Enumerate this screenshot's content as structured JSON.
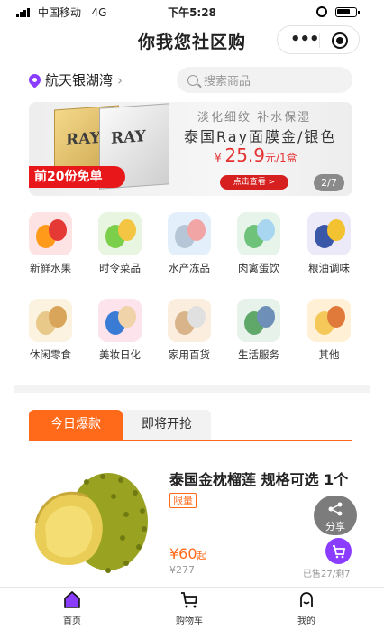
{
  "status_bar": {
    "carrier": "中国移动",
    "network": "4G",
    "time": "下午5:28"
  },
  "header": {
    "title": "你我您社区购"
  },
  "location": {
    "name": "航天银湖湾"
  },
  "search": {
    "placeholder": "搜索商品"
  },
  "banner": {
    "subtitle": "淡化细纹 补水保湿",
    "title": "泰国Ray面膜金/银色",
    "price_symbol": "¥",
    "price": "25.9",
    "price_unit": "元/1盒",
    "button_label": "点击查看 >",
    "promo": "前20份免单",
    "brand_text": "RAY",
    "page_indicator": "2/7"
  },
  "categories": [
    {
      "label": "新鲜水果",
      "icon": "fruit-icon"
    },
    {
      "label": "时令菜品",
      "icon": "vegetable-icon"
    },
    {
      "label": "水产冻品",
      "icon": "seafood-icon"
    },
    {
      "label": "肉禽蛋饮",
      "icon": "meat-egg-icon"
    },
    {
      "label": "粮油调味",
      "icon": "grain-oil-icon"
    },
    {
      "label": "休闲零食",
      "icon": "snack-icon"
    },
    {
      "label": "美妆日化",
      "icon": "cosmetics-icon"
    },
    {
      "label": "家用百货",
      "icon": "household-icon"
    },
    {
      "label": "生活服务",
      "icon": "service-icon"
    },
    {
      "label": "其他",
      "icon": "other-icon"
    }
  ],
  "tabs": [
    {
      "label": "今日爆款"
    },
    {
      "label": "即将开抢"
    }
  ],
  "product": {
    "name": "泰国金枕榴莲 规格可选 1个",
    "tag": "限量",
    "price": "¥60",
    "price_suffix": "起",
    "original_price": "¥277",
    "sold": "已售27/剩7"
  },
  "share": {
    "label": "分享"
  },
  "tabbar": [
    {
      "label": "首页"
    },
    {
      "label": "购物车"
    },
    {
      "label": "我的"
    }
  ],
  "colors": {
    "accent": "#ff6a1a",
    "brand_purple": "#8a3dff",
    "banner_red": "#e8181a"
  }
}
